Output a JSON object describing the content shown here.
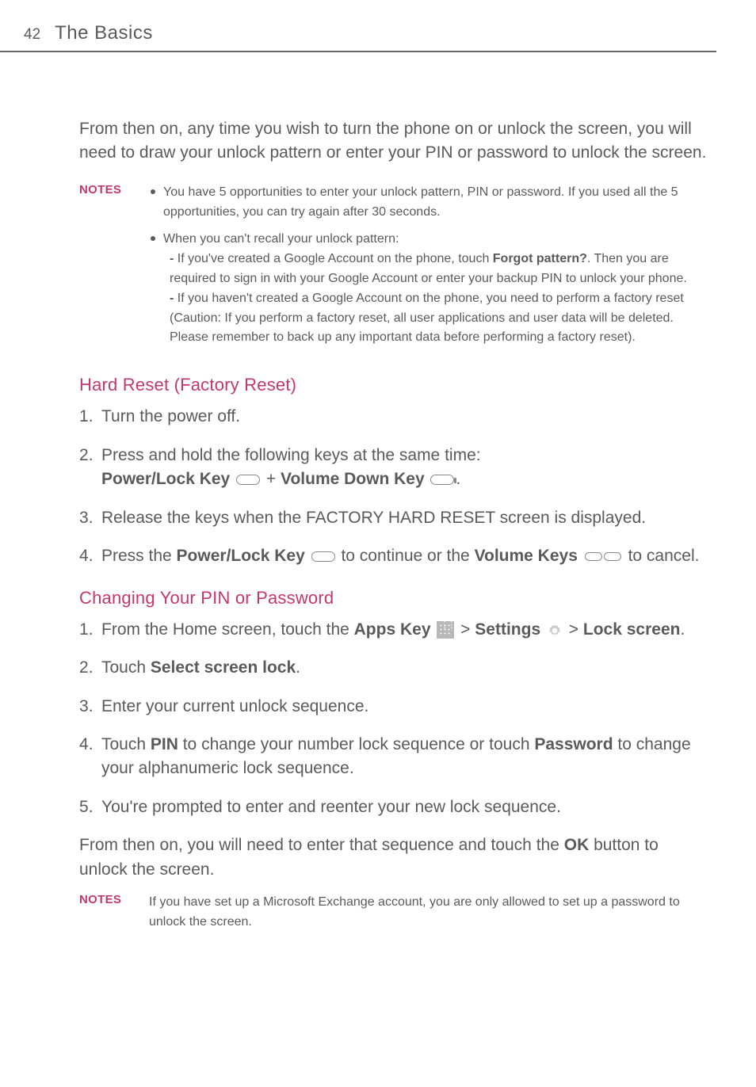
{
  "header": {
    "page_number": "42",
    "title": "The Basics"
  },
  "intro": "From then on, any time you wish to turn the phone on or unlock the screen, you will need to draw your unlock pattern or enter your PIN or password to unlock the screen.",
  "notes1": {
    "label": "NOTES",
    "b1": "You have 5 opportunities to enter your unlock pattern, PIN or password. If you used all the 5 opportunities, you can try again after 30 seconds.",
    "b2_intro": "When you can't recall your unlock pattern:",
    "b2_s1_pre": "If you've created a Google Account on the phone, touch ",
    "b2_s1_bold": "Forgot pattern?",
    "b2_s1_post": ". Then you are required to sign in with your Google Account or enter your backup PIN to unlock your phone.",
    "b2_s2": "If you haven't created a Google Account on the phone, you need to perform a factory reset (Caution: If you perform a factory reset, all user applications and user data will be deleted. Please remember to back up any important data before performing a factory reset)."
  },
  "section1": {
    "heading": "Hard Reset (Factory Reset)",
    "s1": "Turn the power off.",
    "s2_pre": "Press and hold the following keys at the same time:",
    "s2_key1": "Power/Lock Key ",
    "s2_plus": " + ",
    "s2_key2": "Volume Down Key ",
    "s2_end": ".",
    "s3": "Release the keys when the FACTORY HARD RESET screen is displayed.",
    "s4_pre": "Press the ",
    "s4_b1": "Power/Lock Key ",
    "s4_mid": " to continue or the ",
    "s4_b2": "Volume Keys ",
    "s4_post": " to cancel."
  },
  "section2": {
    "heading": "Changing Your PIN or Password",
    "s1_pre": "From the Home screen, touch the ",
    "s1_b1": "Apps Key ",
    "s1_gt1": " > ",
    "s1_b2": "Settings ",
    "s1_gt2": " > ",
    "s1_b3": "Lock screen",
    "s1_end": ".",
    "s2_pre": "Touch ",
    "s2_b1": "Select screen lock",
    "s2_end": ".",
    "s3": "Enter your current unlock sequence.",
    "s4_pre": "Touch ",
    "s4_b1": "PIN",
    "s4_mid": " to change your number lock sequence or touch ",
    "s4_b2": "Password",
    "s4_post": " to change your alphanumeric lock sequence.",
    "s5": "You're prompted to enter and reenter your new lock sequence.",
    "follow_pre": "From then on, you will need to enter that sequence and touch the ",
    "follow_b": "OK",
    "follow_post": " button to unlock the screen."
  },
  "notes2": {
    "label": "NOTES",
    "text": "If you have set up a Microsoft Exchange account, you are only allowed to set up a password to unlock the screen."
  }
}
